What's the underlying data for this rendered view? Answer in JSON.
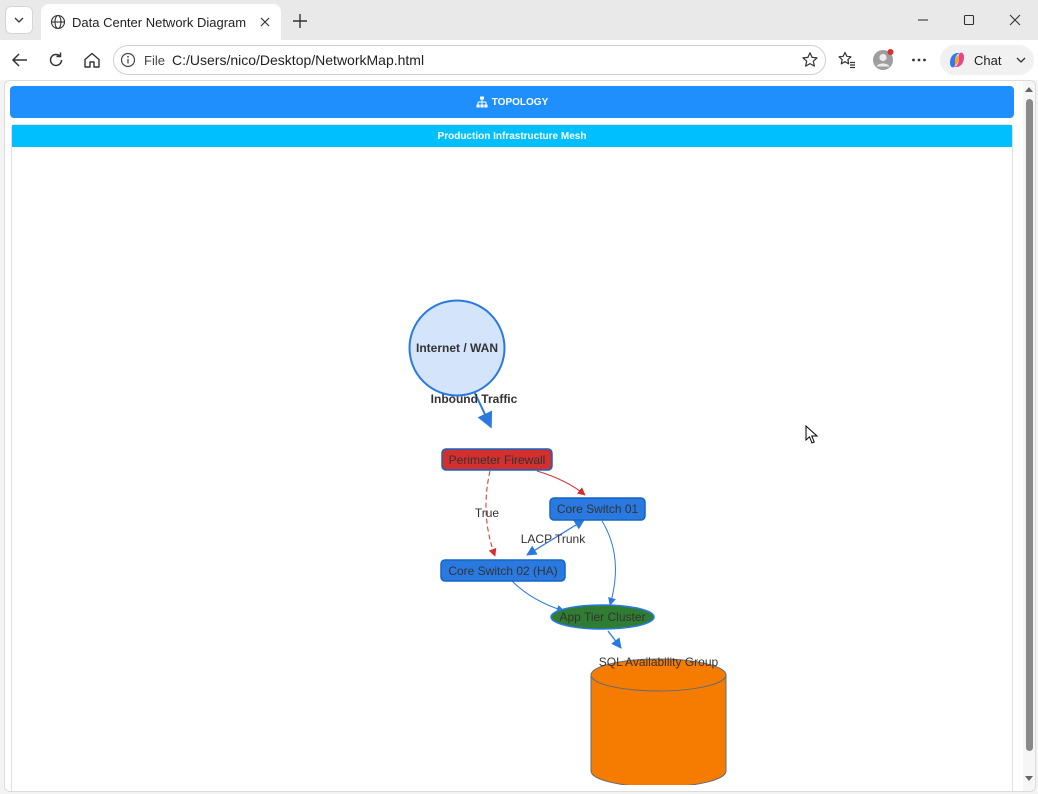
{
  "browser": {
    "tab_title": "Data Center Network Diagram",
    "address_scheme": "File",
    "address_url": "C:/Users/nico/Desktop/NetworkMap.html",
    "chat_label": "Chat"
  },
  "page": {
    "topbar_label": "TOPOLOGY",
    "panel_title": "Production Infrastructure Mesh"
  },
  "diagram": {
    "nodes": {
      "internet": "Internet / WAN",
      "firewall": "Perimeter Firewall",
      "core1": "Core Switch 01",
      "core2": "Core Switch 02 (HA)",
      "app": "App Tier Cluster",
      "sql": "SQL Availability Group"
    },
    "edges": {
      "inbound": "Inbound Traffic",
      "failover": "True",
      "lacp": "LACP Trunk"
    },
    "colors": {
      "blue": "#2979e0",
      "red": "#d32f2f",
      "green": "#2e7d32",
      "orange": "#f57c00",
      "internet_fill": "#d3e4fb"
    }
  }
}
